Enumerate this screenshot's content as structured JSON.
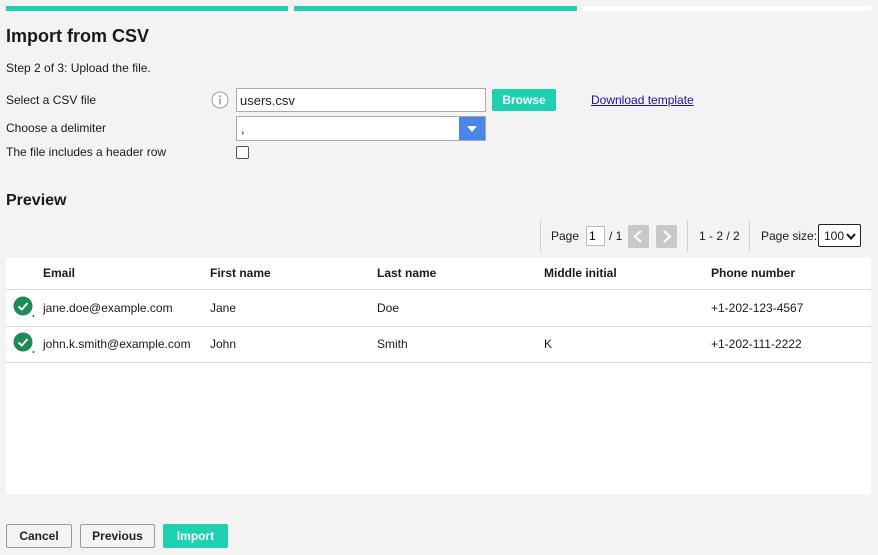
{
  "progress": {
    "current_step": 2,
    "total_steps": 3
  },
  "title": "Import from CSV",
  "step_text": "Step 2 of 3: Upload the file.",
  "form": {
    "file_label": "Select a CSV file",
    "file_value": "users.csv",
    "browse_label": "Browse",
    "template_link": "Download template",
    "delimiter_label": "Choose a delimiter",
    "delimiter_value": ",",
    "header_row_label": "The file includes a header row",
    "header_row_checked": false
  },
  "preview": {
    "title": "Preview",
    "pager": {
      "page_label": "Page",
      "page_value": "1",
      "page_total": "/ 1",
      "range": "1 - 2 / 2",
      "page_size_label": "Page size:",
      "page_size_value": "100"
    },
    "columns": [
      "Email",
      "First name",
      "Last name",
      "Middle initial",
      "Phone number"
    ],
    "rows": [
      {
        "status": "valid",
        "email": "jane.doe@example.com",
        "first": "Jane",
        "last": "Doe",
        "middle": "",
        "phone": "+1-202-123-4567"
      },
      {
        "status": "valid",
        "email": "john.k.smith@example.com",
        "first": "John",
        "last": "Smith",
        "middle": "K",
        "phone": "+1-202-111-2222"
      }
    ]
  },
  "footer": {
    "cancel_label": "Cancel",
    "previous_label": "Previous",
    "import_label": "Import"
  },
  "colors": {
    "accent": "#1fd1b1",
    "select_arrow": "#4a86e8",
    "valid": "#1e8a5a",
    "link": "#1a0dab"
  },
  "icons": {
    "info": "info-icon",
    "prev_page": "chevron-left-icon",
    "next_page": "chevron-right-icon",
    "valid": "check-circle-icon",
    "dropdown": "chevron-down-icon"
  }
}
